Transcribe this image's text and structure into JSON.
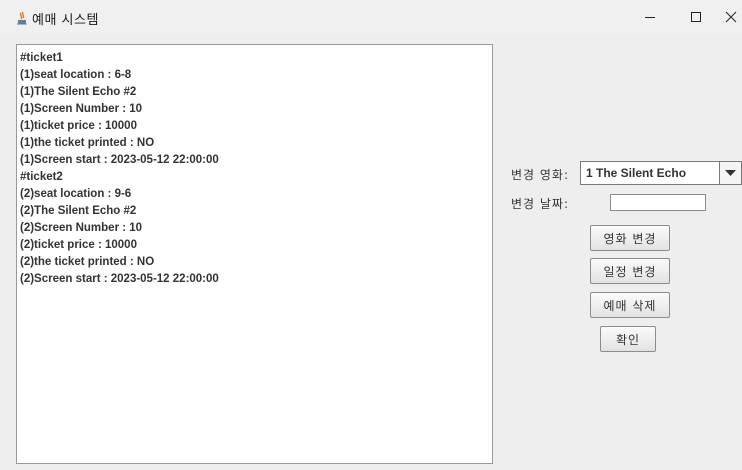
{
  "window": {
    "title": "예매 시스템"
  },
  "ticket_text": {
    "lines": [
      "#ticket1",
      "(1)seat location : 6-8",
      "(1)The Silent Echo #2",
      "(1)Screen Number : 10",
      "(1)ticket price : 10000",
      "(1)the ticket printed : NO",
      "(1)Screen start : 2023-05-12 22:00:00",
      "#ticket2",
      "(2)seat location : 9-6",
      "(2)The Silent Echo #2",
      "(2)Screen Number : 10",
      "(2)ticket price : 10000",
      "(2)the ticket printed : NO",
      "(2)Screen start : 2023-05-12 22:00:00"
    ]
  },
  "form": {
    "movie_label": "변경 영화:",
    "movie_selected": "1 The Silent Echo",
    "date_label": "변경 날짜:",
    "date_value": ""
  },
  "buttons": {
    "change_movie": "영화 변경",
    "change_schedule": "일정 변경",
    "delete_booking": "예매 삭제",
    "confirm": "확인"
  },
  "icons": {
    "app": "java-cup-icon",
    "minimize": "minimize-icon",
    "maximize": "maximize-icon",
    "close": "close-icon",
    "dropdown": "triangle-down-icon"
  }
}
